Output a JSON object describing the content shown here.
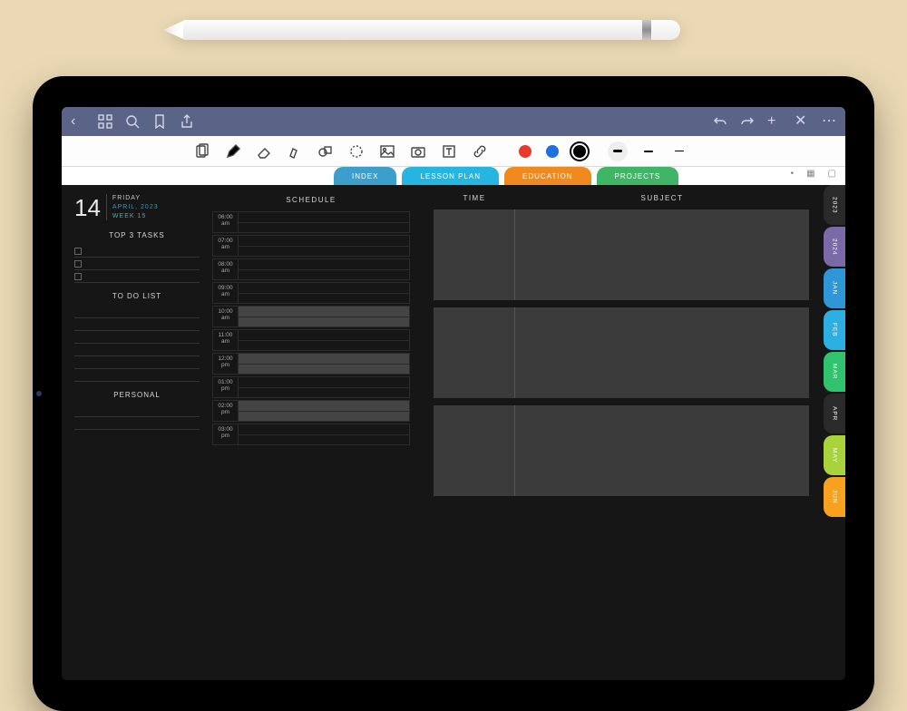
{
  "date": {
    "day_num": "14",
    "weekday": "FRIDAY",
    "month_year": "APRIL, 2023",
    "week": "WEEK 15"
  },
  "left_sections": {
    "tasks": "TOP 3 TASKS",
    "todo": "TO DO LIST",
    "personal": "PERSONAL"
  },
  "schedule": {
    "header": "SCHEDULE",
    "slots": [
      {
        "t": "06:00",
        "m": "am",
        "shade": false
      },
      {
        "t": "07:00",
        "m": "am",
        "shade": false
      },
      {
        "t": "08:00",
        "m": "am",
        "shade": false
      },
      {
        "t": "09:00",
        "m": "am",
        "shade": false
      },
      {
        "t": "10:00",
        "m": "am",
        "shade": true
      },
      {
        "t": "11:00",
        "m": "am",
        "shade": false
      },
      {
        "t": "12:00",
        "m": "pm",
        "shade": true
      },
      {
        "t": "01:00",
        "m": "pm",
        "shade": false
      },
      {
        "t": "02:00",
        "m": "pm",
        "shade": true
      },
      {
        "t": "03:00",
        "m": "pm",
        "shade": false
      }
    ]
  },
  "right": {
    "time": "TIME",
    "subject": "SUBJECT"
  },
  "tabs": [
    {
      "label": "INDEX",
      "color": "#3b9ecb"
    },
    {
      "label": "LESSON PLAN",
      "color": "#24b6e0"
    },
    {
      "label": "EDUCATION",
      "color": "#f08a1f"
    },
    {
      "label": "PROJECTS",
      "color": "#3fb566"
    }
  ],
  "side_tabs": [
    {
      "label": "2023",
      "color": "#2a2a2a"
    },
    {
      "label": "2024",
      "color": "#7b6aa8"
    },
    {
      "label": "JAN",
      "color": "#2f97d8"
    },
    {
      "label": "FEB",
      "color": "#2cb0e3"
    },
    {
      "label": "MAR",
      "color": "#31c26e"
    },
    {
      "label": "APR",
      "color": "#2a2a2a"
    },
    {
      "label": "MAY",
      "color": "#a9d33b"
    },
    {
      "label": "JUN",
      "color": "#f6a21e"
    }
  ],
  "colors": {
    "red": "#e63a2e",
    "blue": "#1f6fe0",
    "black": "#000000"
  }
}
